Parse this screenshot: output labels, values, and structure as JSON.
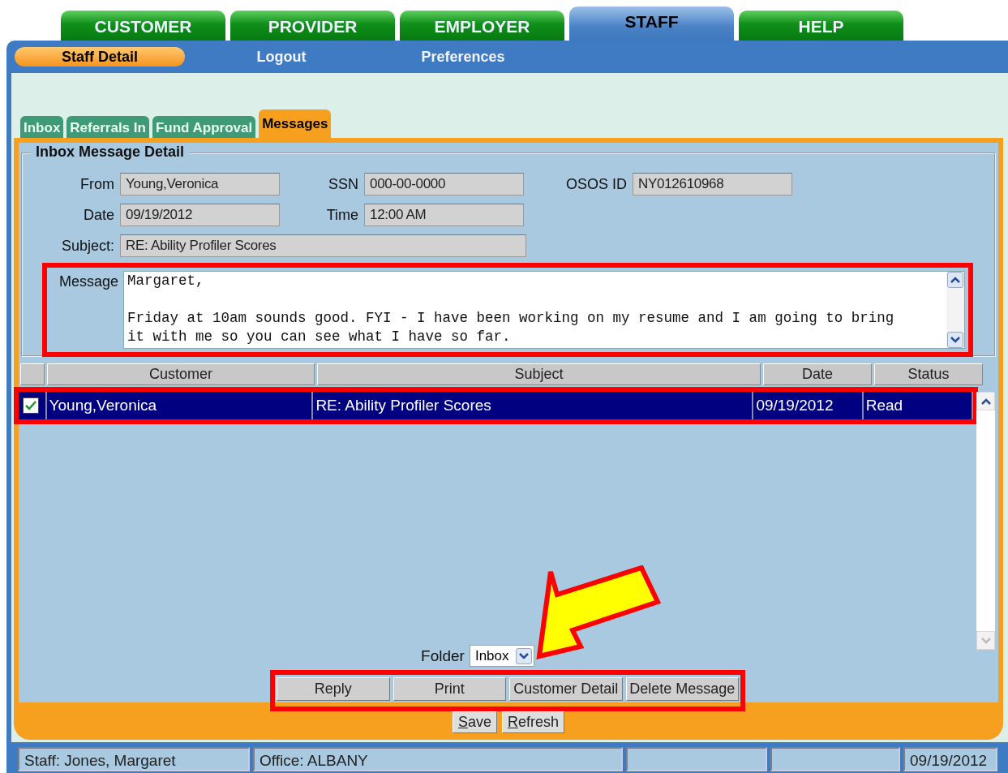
{
  "top_tabs": [
    {
      "label": "CUSTOMER",
      "selected": false
    },
    {
      "label": "PROVIDER",
      "selected": false
    },
    {
      "label": "EMPLOYER",
      "selected": false
    },
    {
      "label": "STAFF",
      "selected": true
    },
    {
      "label": "HELP",
      "selected": false
    }
  ],
  "nav": [
    {
      "label": "Staff Detail",
      "selected": true
    },
    {
      "label": "Logout",
      "selected": false
    },
    {
      "label": "Preferences",
      "selected": false
    }
  ],
  "sub_tabs": [
    {
      "label": "Inbox",
      "selected": false
    },
    {
      "label": "Referrals In",
      "selected": false
    },
    {
      "label": "Fund Approval",
      "selected": false
    },
    {
      "label": "Messages",
      "selected": true
    }
  ],
  "detail": {
    "legend": "Inbox Message Detail",
    "rows": [
      [
        {
          "label": "From",
          "value": "Young,Veronica"
        },
        {
          "label": "SSN",
          "value": "000-00-0000"
        },
        {
          "label": "OSOS ID",
          "value": "NY012610968"
        }
      ],
      [
        {
          "label": "Date",
          "value": "09/19/2012"
        },
        {
          "label": "Time",
          "value": "12:00 AM"
        }
      ],
      [
        {
          "label": "Subject:",
          "value": "RE: Ability Profiler Scores",
          "wide": true
        }
      ]
    ],
    "message": {
      "label": "Message",
      "value": "Margaret,\n\nFriday at 10am sounds good. FYI - I have been working on my resume and I am going to bring\nit with me so you can see what I have so far.",
      "highlighted": true
    }
  },
  "grid": {
    "columns": [
      "Customer",
      "Subject",
      "Date",
      "Status"
    ],
    "rows": [
      {
        "checked": true,
        "selected": true,
        "highlighted": true,
        "cells": [
          "Young,Veronica",
          "RE: Ability Profiler Scores",
          "09/19/2012",
          "Read"
        ]
      }
    ]
  },
  "folder": {
    "label": "Folder",
    "value": "Inbox",
    "pointer_arrow": true
  },
  "actions": {
    "highlighted": true,
    "buttons": [
      "Reply",
      "Print",
      "Customer Detail",
      "Delete Message"
    ]
  },
  "footer_buttons": [
    "Save",
    "Refresh"
  ],
  "status_bar": {
    "staff": "Staff: Jones, Margaret",
    "office": "Office: ALBANY",
    "date": "09/19/2012"
  }
}
